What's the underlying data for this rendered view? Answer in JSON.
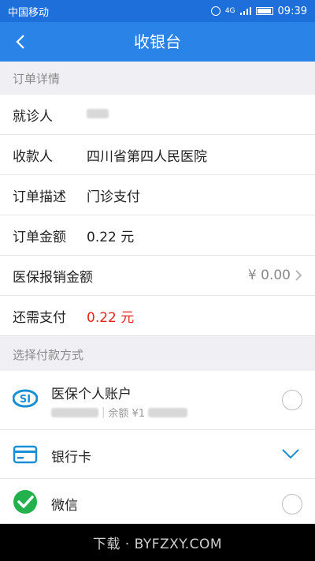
{
  "statusbar": {
    "carrier": "中国移动",
    "network": "4G",
    "time": "09:39"
  },
  "titlebar": {
    "title": "收银台"
  },
  "order_section": {
    "header": "订单详情"
  },
  "order": {
    "patient_label": "就诊人",
    "payee_label": "收款人",
    "payee_value": "四川省第四人民医院",
    "desc_label": "订单描述",
    "desc_value": "门诊支付",
    "amount_label": "订单金额",
    "amount_value": "0.22 元",
    "insurance_label": "医保报销金额",
    "insurance_value": "¥ 0.00",
    "due_label": "还需支付",
    "due_value": "0.22 元"
  },
  "payment_section": {
    "header": "选择付款方式"
  },
  "payment_methods": {
    "si": {
      "name": "医保个人账户",
      "balance_label": "余额 ¥1",
      "icon": "social-insurance-icon"
    },
    "bank": {
      "name": "银行卡",
      "icon": "bank-card-icon"
    },
    "wechat": {
      "name": "微信",
      "icon": "wechat-icon"
    }
  },
  "navbar": {
    "watermark": "下载 · BYFZXY.COM"
  },
  "colors": {
    "header_blue": "#2a83e6",
    "status_blue": "#1e6fd9",
    "amount_red": "#e5241b",
    "wechat_green": "#22b14c"
  }
}
